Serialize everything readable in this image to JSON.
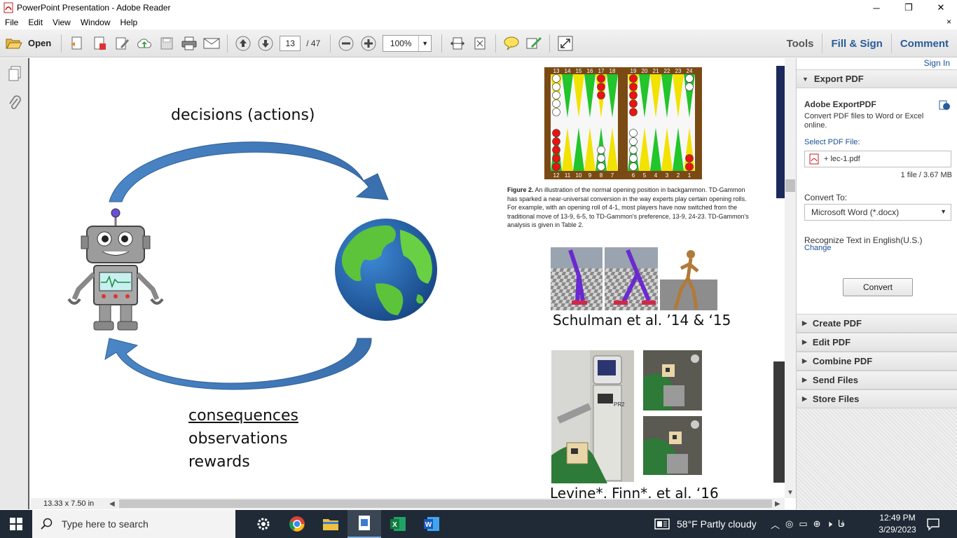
{
  "window": {
    "title": "PowerPoint Presentation - Adobe Reader",
    "minimize": "─",
    "maximize": "❐",
    "close": "✕"
  },
  "menu": {
    "items": [
      "File",
      "Edit",
      "View",
      "Window",
      "Help"
    ],
    "close": "×"
  },
  "toolbar": {
    "open_label": "Open",
    "page_current": "13",
    "page_total": "/ 47",
    "zoom": "100%",
    "tools": "Tools",
    "fill_sign": "Fill & Sign",
    "comment": "Comment"
  },
  "slide": {
    "decisions": "decisions (actions)",
    "consequences": "consequences",
    "observations": "observations",
    "rewards": "rewards",
    "figure_label": "Figure 2.",
    "figure_caption": "An illustration of the normal opening position in backgammon. TD-Gammon has sparked a near-universal conversion in the way experts play certain opening rolls. For example, with an opening roll of 4-1, most players have now switched from the traditional move of 13-9, 6-5, to TD-Gammon's preference, 13-9, 24-23. TD-Gammon's analysis is given in Table 2.",
    "schulman": "Schulman et al. ’14 & ‘15",
    "levine": "Levine*, Finn*, et al. ‘16",
    "board_top_left": [
      "13",
      "14",
      "15",
      "16",
      "17",
      "18"
    ],
    "board_top_right": [
      "19",
      "20",
      "21",
      "22",
      "23",
      "24"
    ],
    "board_bottom_left": [
      "12",
      "11",
      "10",
      "9",
      "8",
      "7"
    ],
    "board_bottom_right": [
      "6",
      "5",
      "4",
      "3",
      "2",
      "1"
    ],
    "robot_tag": "PR2"
  },
  "status": {
    "page_size": "13.33 x 7.50 in"
  },
  "right_panel": {
    "sign_in": "Sign In",
    "export_pdf": "Export PDF",
    "adobe_exportpdf": "Adobe ExportPDF",
    "description": "Convert PDF files to Word or Excel online.",
    "select_pdf": "Select PDF File:",
    "file_name": "+ lec-1.pdf",
    "file_info": "1 file / 3.67 MB",
    "convert_to": "Convert To:",
    "convert_format": "Microsoft Word (*.docx)",
    "recognize": "Recognize Text in English(U.S.)",
    "change": "Change",
    "convert_button": "Convert",
    "sections": [
      "Create PDF",
      "Edit PDF",
      "Combine PDF",
      "Send Files",
      "Store Files"
    ]
  },
  "taskbar": {
    "search_placeholder": "Type here to search",
    "weather": "58°F  Partly cloudy",
    "language": "فا",
    "time": "12:49 PM",
    "date": "3/29/2023"
  },
  "colors": {
    "accent_blue": "#2a5c9a",
    "link_blue": "#1a4f97",
    "arrow_blue": "#3c78b8",
    "board_brown": "#7a4a14",
    "taskbar": "#1f2a36"
  }
}
